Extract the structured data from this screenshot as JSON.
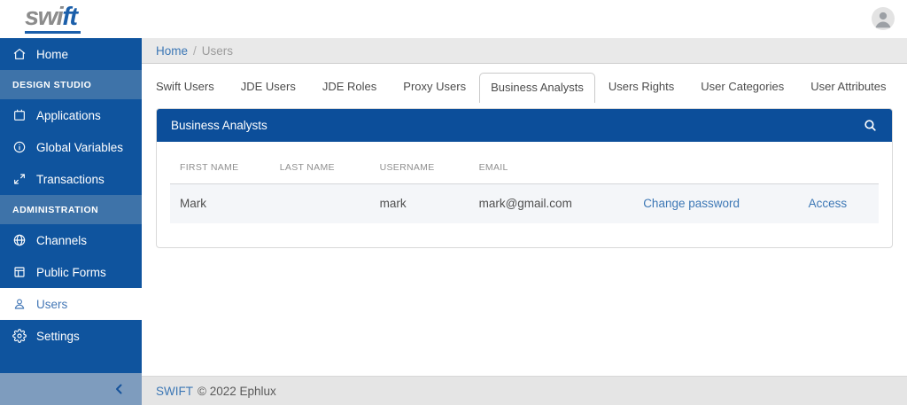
{
  "colors": {
    "sidebar_blue": "#0F549E",
    "section_blue": "#3E73A9",
    "collapse_blue": "#7E9CBE",
    "card_header_blue": "#0C4E9A",
    "link_blue": "#3C77B5",
    "logo_gray": "#8C8C8C",
    "logo_blue": "#1B5FAA",
    "row_bg": "#F4F6F9"
  },
  "logo": {
    "part1": "swi",
    "part2": "ft"
  },
  "topbar": {
    "avatar_icon": "person-icon"
  },
  "sidebar": {
    "home": {
      "label": "Home",
      "icon": "home-icon"
    },
    "sections": [
      {
        "label": "DESIGN STUDIO",
        "items": [
          {
            "label": "Applications",
            "icon": "applications-icon"
          },
          {
            "label": "Global Variables",
            "icon": "info-circle-icon"
          },
          {
            "label": "Transactions",
            "icon": "expand-arrows-icon"
          }
        ]
      },
      {
        "label": "ADMINISTRATION",
        "items": [
          {
            "label": "Channels",
            "icon": "globe-icon"
          },
          {
            "label": "Public Forms",
            "icon": "form-icon"
          },
          {
            "label": "Users",
            "icon": "user-icon",
            "active": true
          },
          {
            "label": "Settings",
            "icon": "gear-icon"
          }
        ]
      }
    ],
    "collapse_icon": "chevron-left-icon"
  },
  "breadcrumb": {
    "home": "Home",
    "separator": "/",
    "current": "Users"
  },
  "tabs": {
    "items": [
      "Swift Users",
      "JDE Users",
      "JDE Roles",
      "Proxy Users",
      "Business Analysts",
      "Users Rights",
      "User Categories",
      "User Attributes"
    ],
    "active": "Business Analysts"
  },
  "card": {
    "title": "Business Analysts",
    "search_icon": "search-icon",
    "table": {
      "headers": [
        "FIRST NAME",
        "LAST NAME",
        "USERNAME",
        "EMAIL"
      ],
      "rows": [
        {
          "first_name": "Mark",
          "last_name": "",
          "username": "mark",
          "email": "mark@gmail.com",
          "change_password_label": "Change password",
          "access_label": "Access"
        }
      ]
    }
  },
  "footer": {
    "brand": "SWIFT",
    "copyright": "© 2022 Ephlux"
  }
}
